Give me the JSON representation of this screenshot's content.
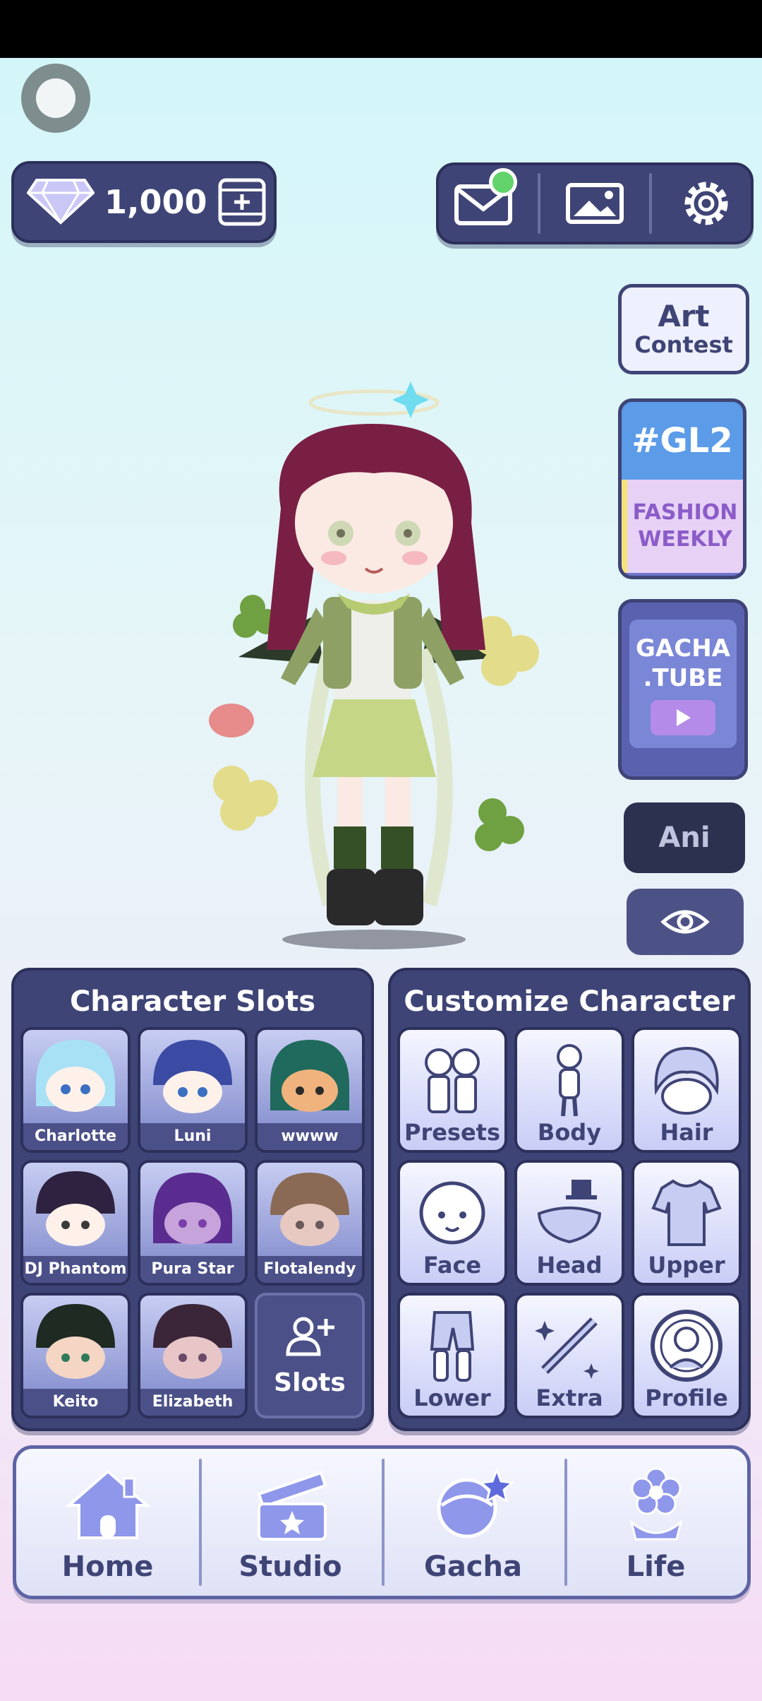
{
  "currency": {
    "gems": "1,000"
  },
  "side_cards": {
    "art_contest": {
      "line1": "Art",
      "line2": "Contest"
    },
    "gl2": {
      "tag": "#GL2",
      "line1": "FASHION",
      "line2": "WEEKLY"
    },
    "gacha_tube": {
      "line1": "GACHA",
      "line2": ".TUBE"
    },
    "ani_label": "Ani"
  },
  "character_slots": {
    "title": "Character Slots",
    "slots": [
      {
        "name": "Charlotte",
        "hair": "#a8e1f5"
      },
      {
        "name": "Luni",
        "hair": "#3b4aa3"
      },
      {
        "name": "wwww",
        "hair": "#1f6a5c"
      },
      {
        "name": "DJ Phantom",
        "hair": "#2e2240"
      },
      {
        "name": "Pura Star",
        "hair": "#5a2c8f"
      },
      {
        "name": "Flotalendy",
        "hair": "#8a6a55"
      },
      {
        "name": "Keito",
        "hair": "#1e2a22"
      },
      {
        "name": "Elizabeth",
        "hair": "#3a2638"
      }
    ],
    "add_label": "Slots"
  },
  "customize": {
    "title": "Customize Character",
    "items": [
      "Presets",
      "Body",
      "Hair",
      "Face",
      "Head",
      "Upper",
      "Lower",
      "Extra",
      "Profile"
    ]
  },
  "nav": {
    "items": [
      "Home",
      "Studio",
      "Gacha",
      "Life"
    ]
  },
  "colors": {
    "panel": "#3f4476",
    "accent": "#62d36a",
    "nav_icon": "#7b84e0"
  }
}
